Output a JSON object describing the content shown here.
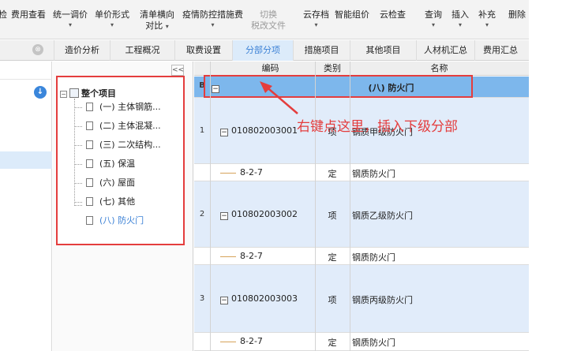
{
  "ribbon": {
    "items": [
      {
        "label": "检",
        "arrow": ""
      },
      {
        "label": "费用查看",
        "arrow": ""
      },
      {
        "label": "统一调价",
        "arrow": "▾"
      },
      {
        "label": "单价形式",
        "arrow": "▾"
      },
      {
        "label": "清单横向",
        "label2": "对比",
        "arrow": "▾"
      },
      {
        "label": "疫情防控措施费",
        "arrow": "▾"
      },
      {
        "label": "切换",
        "label2": "税改文件",
        "disabled": true
      },
      {
        "label": "云存档",
        "arrow": "▾"
      },
      {
        "label": "智能组价",
        "arrow": ""
      },
      {
        "label": "云检查",
        "arrow": ""
      },
      {
        "label": "查询",
        "arrow": "▾"
      },
      {
        "label": "插入",
        "arrow": "▾"
      },
      {
        "label": "补充",
        "arrow": "▾"
      },
      {
        "label": "删除",
        "arrow": ""
      }
    ]
  },
  "tabs": [
    {
      "label": "造价分析"
    },
    {
      "label": "工程概况"
    },
    {
      "label": "取费设置"
    },
    {
      "label": "分部分项",
      "active": true
    },
    {
      "label": "措施项目"
    },
    {
      "label": "其他项目"
    },
    {
      "label": "人材机汇总"
    },
    {
      "label": "费用汇总"
    }
  ],
  "tree": {
    "collapse_label": "<<",
    "root": "整个项目",
    "children": [
      "(一) 主体钢筋...",
      "(二) 主体混凝...",
      "(三) 二次结构...",
      "(五) 保温",
      "(六) 屋面",
      "(七) 其他",
      "(八) 防火门"
    ]
  },
  "grid": {
    "headers": {
      "code": "编码",
      "category": "类别",
      "name": "名称"
    },
    "left_col_header": "B",
    "section": {
      "title": "(八) 防火门"
    },
    "rows": [
      {
        "no": "1",
        "code": "010802003001",
        "category": "项",
        "name": "钢质甲级防火门"
      },
      {
        "no": "",
        "code": "8-2-7",
        "category": "定",
        "name": "钢质防火门"
      },
      {
        "no": "2",
        "code": "010802003002",
        "category": "项",
        "name": "钢质乙级防火门"
      },
      {
        "no": "",
        "code": "8-2-7",
        "category": "定",
        "name": "钢质防火门"
      },
      {
        "no": "3",
        "code": "010802003003",
        "category": "项",
        "name": "钢质丙级防火门"
      },
      {
        "no": "",
        "code": "8-2-7",
        "category": "定",
        "name": "钢质防火门"
      }
    ]
  },
  "annotation": "右键点这里，插入下级分部",
  "colors": {
    "highlight_red": "#e43d3d",
    "accent_blue": "#3d82d6",
    "section_blue": "#7db7ec",
    "item_row": "#e1ecfa"
  }
}
